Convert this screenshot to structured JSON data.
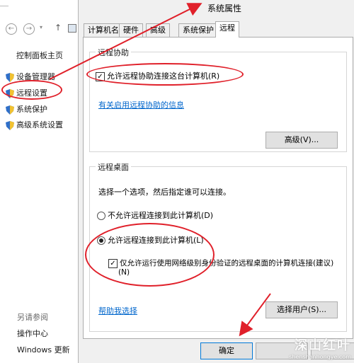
{
  "left_pane": {
    "home_link": "控制面板主页",
    "items": [
      {
        "label": "设备管理器",
        "icon": "shield-icon"
      },
      {
        "label": "远程设置",
        "icon": "shield-icon"
      },
      {
        "label": "系统保护",
        "icon": "shield-icon"
      },
      {
        "label": "高级系统设置",
        "icon": "shield-icon"
      }
    ],
    "see_also_heading": "另请参阅",
    "see_also_links": [
      "操作中心",
      "Windows 更新"
    ]
  },
  "dialog": {
    "title": "系统属性",
    "tabs": [
      "计算机名",
      "硬件",
      "高级",
      "系统保护",
      "远程"
    ],
    "active_tab": "远程",
    "remote_assistance": {
      "legend": "远程协助",
      "allow_label": "允许远程协助连接这台计算机(R)",
      "allow_checked": true,
      "info_link": "有关启用远程协助的信息",
      "advanced_button": "高级(V)..."
    },
    "remote_desktop": {
      "legend": "远程桌面",
      "instruction": "选择一个选项，然后指定谁可以连接。",
      "option_deny": "不允许远程连接到此计算机(D)",
      "option_allow": "允许远程连接到此计算机(L)",
      "selected": "option_allow",
      "nla_label_line1": "仅允许运行使用网络级别身份验证的远程桌面的计算机连接(建议)",
      "nla_label_line2": "(N)",
      "nla_checked": true,
      "help_link": "帮助我选择",
      "select_users_button": "选择用户(S)..."
    },
    "ok_button": "确定"
  },
  "watermark": {
    "line1": "深山红叶",
    "line2": "shenshanhongye.com"
  },
  "colors": {
    "annotation_red": "#e0202a",
    "link_blue": "#0066cc",
    "dialog_bg": "#f0f0f0"
  }
}
